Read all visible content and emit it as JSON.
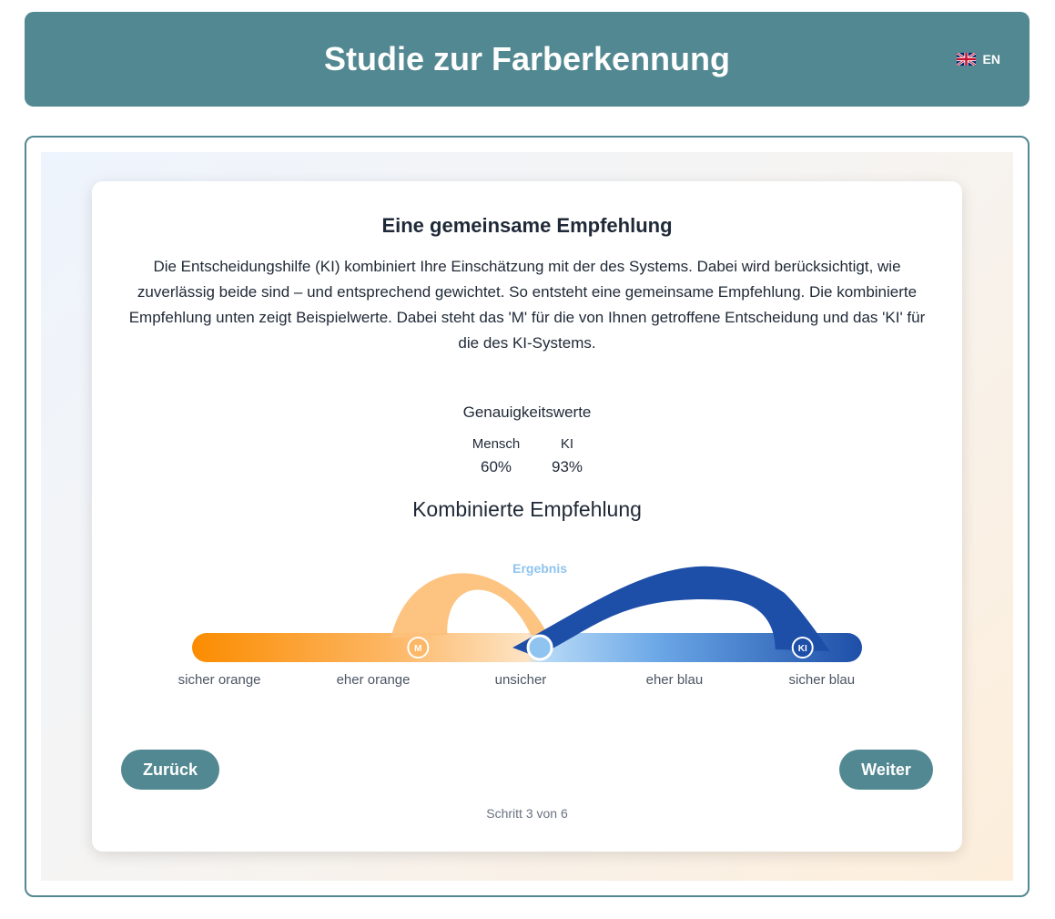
{
  "header": {
    "title": "Studie zur Farberkennung",
    "language_label": "EN"
  },
  "card": {
    "title": "Eine gemeinsame Empfehlung",
    "description": "Die Entscheidungshilfe (KI) kombiniert Ihre Einschätzung mit der des Systems. Dabei wird berücksichtigt, wie zuverlässig beide sind – und entsprechend gewichtet. So entsteht eine gemeinsame Empfehlung. Die kombinierte Empfehlung unten zeigt Beispielwerte. Dabei steht das 'M' für die von Ihnen getroffene Entscheidung und das 'KI' für die des KI-Systems."
  },
  "accuracy": {
    "title": "Genauigkeitswerte",
    "human_label": "Mensch",
    "human_value": "60%",
    "ai_label": "KI",
    "ai_value": "93%"
  },
  "combined": {
    "title": "Kombinierte Empfehlung",
    "result_label": "Ergebnis",
    "human_marker": "M",
    "ai_marker": "KI",
    "human_position": 0.33,
    "ai_position": 0.93,
    "result_position": 0.52,
    "scale_labels": [
      "sicher orange",
      "eher orange",
      "unsicher",
      "eher blau",
      "sicher blau"
    ]
  },
  "colors": {
    "primary": "#528891",
    "orange": "#fb8c00",
    "blue": "#1e4fa8",
    "result": "#8fc3f0"
  },
  "nav": {
    "back_label": "Zurück",
    "next_label": "Weiter",
    "step_text": "Schritt 3 von 6"
  }
}
